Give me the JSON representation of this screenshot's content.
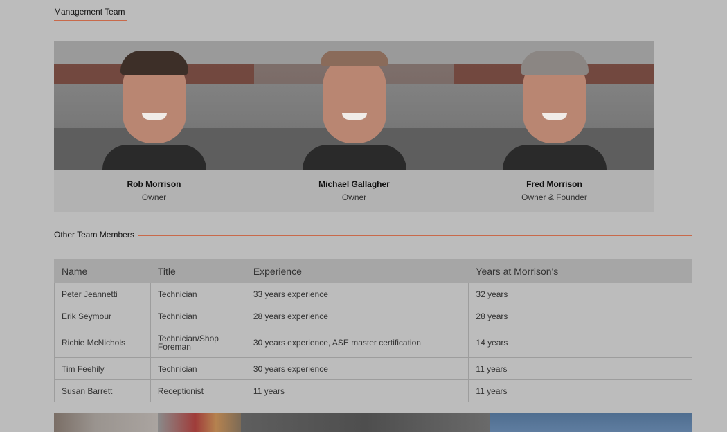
{
  "management": {
    "heading": "Management Team",
    "members": [
      {
        "name": "Rob Morrison",
        "role": "Owner"
      },
      {
        "name": "Michael Gallagher",
        "role": "Owner"
      },
      {
        "name": "Fred Morrison",
        "role": "Owner & Founder"
      }
    ]
  },
  "other": {
    "heading": "Other Team Members",
    "columns": [
      "Name",
      "Title",
      "Experience",
      "Years at Morrison's"
    ],
    "rows": [
      [
        "Peter Jeannetti",
        "Technician",
        "33 years experience",
        "32 years"
      ],
      [
        "Erik Seymour",
        "Technician",
        "28 years experience",
        "28 years"
      ],
      [
        "Richie McNichols",
        "Technician/Shop Foreman",
        "30 years experience, ASE master certification",
        "14 years"
      ],
      [
        "Tim Feehily",
        "Technician",
        "30 years experience",
        "11 years"
      ],
      [
        "Susan Barrett",
        "Receptionist",
        "11 years",
        "11 years"
      ]
    ]
  },
  "colors": {
    "background": "#bcbcbc",
    "accent_rule": "#c8694a",
    "table_header": "#a6a6a6"
  }
}
